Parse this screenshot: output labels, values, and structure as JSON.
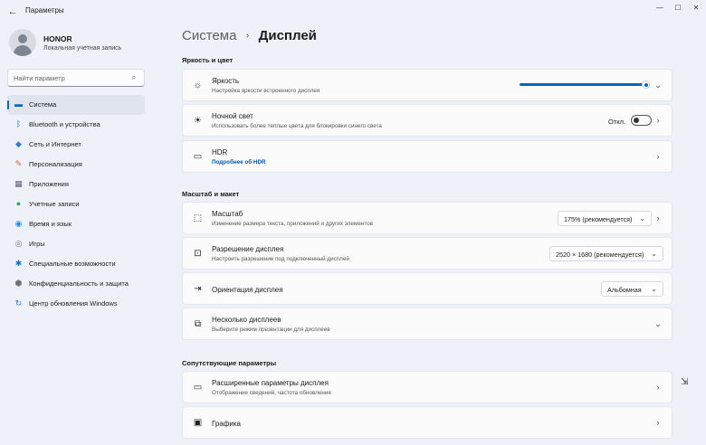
{
  "window": {
    "title": "Параметры",
    "back_glyph": "←",
    "min_glyph": "—",
    "max_glyph": "☐",
    "close_glyph": "✕"
  },
  "profile": {
    "name": "HONOR",
    "account_type": "Локальная учетная запись"
  },
  "search": {
    "placeholder": "Найти параметр",
    "icon": "search-icon"
  },
  "nav": [
    {
      "label": "Система",
      "icon": "system-icon",
      "glyph": "▬",
      "color": "#0067c0",
      "active": true
    },
    {
      "label": "Bluetooth и устройства",
      "icon": "bluetooth-icon",
      "glyph": "ᛒ",
      "color": "#0078d4",
      "active": false
    },
    {
      "label": "Сеть и Интернет",
      "icon": "wifi-icon",
      "glyph": "◆",
      "color": "#2b7bd6",
      "active": false
    },
    {
      "label": "Персонализация",
      "icon": "brush-icon",
      "glyph": "✎",
      "color": "#c8642a",
      "active": false
    },
    {
      "label": "Приложения",
      "icon": "apps-icon",
      "glyph": "▦",
      "color": "#5b6575",
      "active": false
    },
    {
      "label": "Учетные записи",
      "icon": "account-icon",
      "glyph": "●",
      "color": "#2fa85a",
      "active": false
    },
    {
      "label": "Время и язык",
      "icon": "globe-icon",
      "glyph": "◉",
      "color": "#1a8ed8",
      "active": false
    },
    {
      "label": "Игры",
      "icon": "gamepad-icon",
      "glyph": "◎",
      "color": "#6b7380",
      "active": false
    },
    {
      "label": "Специальные возможности",
      "icon": "accessibility-icon",
      "glyph": "✱",
      "color": "#1b6fc2",
      "active": false
    },
    {
      "label": "Конфиденциальность и защита",
      "icon": "shield-icon",
      "glyph": "⬢",
      "color": "#6b7380",
      "active": false
    },
    {
      "label": "Центр обновления Windows",
      "icon": "update-icon",
      "glyph": "↻",
      "color": "#1a7fd4",
      "active": false
    }
  ],
  "breadcrumb": {
    "parent": "Система",
    "separator": "›",
    "current": "Дисплей"
  },
  "sections": {
    "brightness_color": "Яркость и цвет",
    "scale_layout": "Масштаб и макет",
    "related": "Сопутствующие параметры"
  },
  "cards": {
    "brightness": {
      "title": "Яркость",
      "subtitle": "Настройка яркости встроенного дисплея",
      "icon": "sun-icon",
      "glyph": "☼",
      "level_percent": 100
    },
    "night_light": {
      "title": "Ночной свет",
      "subtitle": "Использовать более теплые цвета для блокировки синего света",
      "icon": "night-light-icon",
      "glyph": "☀",
      "toggle_label": "Откл.",
      "enabled": false
    },
    "hdr": {
      "title": "HDR",
      "subtitle": "Подробнее об HDR",
      "icon": "hdr-icon",
      "glyph": "▭"
    },
    "scale": {
      "title": "Масштаб",
      "subtitle": "Изменение размера текста, приложений и других элементов",
      "icon": "scale-icon",
      "glyph": "⬚",
      "value": "175% (рекомендуется)"
    },
    "resolution": {
      "title": "Разрешение дисплея",
      "subtitle": "Настроить разрешение под подключенный дисплей",
      "icon": "resolution-icon",
      "glyph": "⊡",
      "value": "2520 × 1680 (рекомендуется)"
    },
    "orientation": {
      "title": "Ориентация дисплея",
      "icon": "orientation-icon",
      "glyph": "⇥",
      "value": "Альбомная"
    },
    "multiple": {
      "title": "Несколько дисплеев",
      "subtitle": "Выберите режим презентации для дисплеев",
      "icon": "multiple-displays-icon",
      "glyph": "⧉"
    },
    "advanced": {
      "title": "Расширенные параметры дисплея",
      "subtitle": "Отображение сведений, частота обновления",
      "icon": "monitor-icon",
      "glyph": "▭"
    },
    "graphics": {
      "title": "Графика",
      "icon": "graphics-icon",
      "glyph": "▣"
    }
  },
  "glyphs": {
    "chevron_right": "›",
    "chevron_down": "⌄",
    "search": "⌕",
    "cursor": "⇲"
  }
}
